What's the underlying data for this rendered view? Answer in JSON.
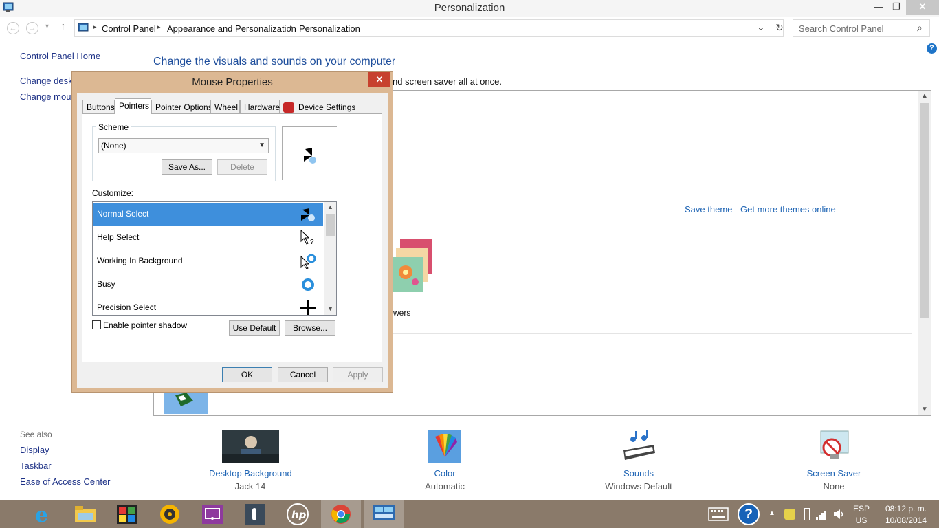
{
  "window": {
    "title": "Personalization",
    "min_glyph": "—",
    "restore_glyph": "❐",
    "close_glyph": "✕"
  },
  "nav": {
    "back_glyph": "←",
    "forward_glyph": "→",
    "recent_glyph": "▾",
    "up_glyph": "↑"
  },
  "address": {
    "crumbs": [
      "Control Panel",
      "Appearance and Personalization",
      "Personalization"
    ],
    "separator": "▸",
    "dropdown_glyph": "⌄",
    "refresh_glyph": "↻"
  },
  "search": {
    "placeholder": "Search Control Panel",
    "icon_glyph": "⌕"
  },
  "left_nav": {
    "home": "Control Panel Home",
    "item1": "Change deskto",
    "item2": "Change mous"
  },
  "help_glyph": "?",
  "main": {
    "heading": "Change the visuals and sounds on your computer",
    "desc_visible": "nd screen saver all at once.",
    "save_theme": "Save theme",
    "get_more_themes": "Get more themes online",
    "theme_name_fragment": "wers"
  },
  "see_also": {
    "heading": "See also",
    "items": [
      "Display",
      "Taskbar",
      "Ease of Access Center"
    ]
  },
  "bottom_items": [
    {
      "label": "Desktop Background",
      "sub": "Jack 14"
    },
    {
      "label": "Color",
      "sub": "Automatic"
    },
    {
      "label": "Sounds",
      "sub": "Windows Default"
    },
    {
      "label": "Screen Saver",
      "sub": "None"
    }
  ],
  "dialog": {
    "title": "Mouse Properties",
    "close_glyph": "✕",
    "tabs": [
      "Buttons",
      "Pointers",
      "Pointer Options",
      "Wheel",
      "Hardware",
      "Device Settings"
    ],
    "active_tab": "Pointers",
    "scheme_label": "Scheme",
    "scheme_value": "(None)",
    "save_as": "Save As...",
    "delete": "Delete",
    "customize_label": "Customize:",
    "cursors": [
      "Normal Select",
      "Help Select",
      "Working In Background",
      "Busy",
      "Precision Select"
    ],
    "selected_cursor": "Normal Select",
    "enable_shadow": "Enable pointer shadow",
    "use_default": "Use Default",
    "browse": "Browse...",
    "ok": "OK",
    "cancel": "Cancel",
    "apply": "Apply"
  },
  "tray": {
    "language": "ESP",
    "region": "US",
    "time": "08:12 p. m.",
    "date": "10/08/2014",
    "help_glyph": "?"
  },
  "colors": {
    "link": "#1e64b4",
    "dialog_frame": "#dcb893",
    "selection": "#3e8fdc",
    "taskbar": "#8a7a6a"
  }
}
